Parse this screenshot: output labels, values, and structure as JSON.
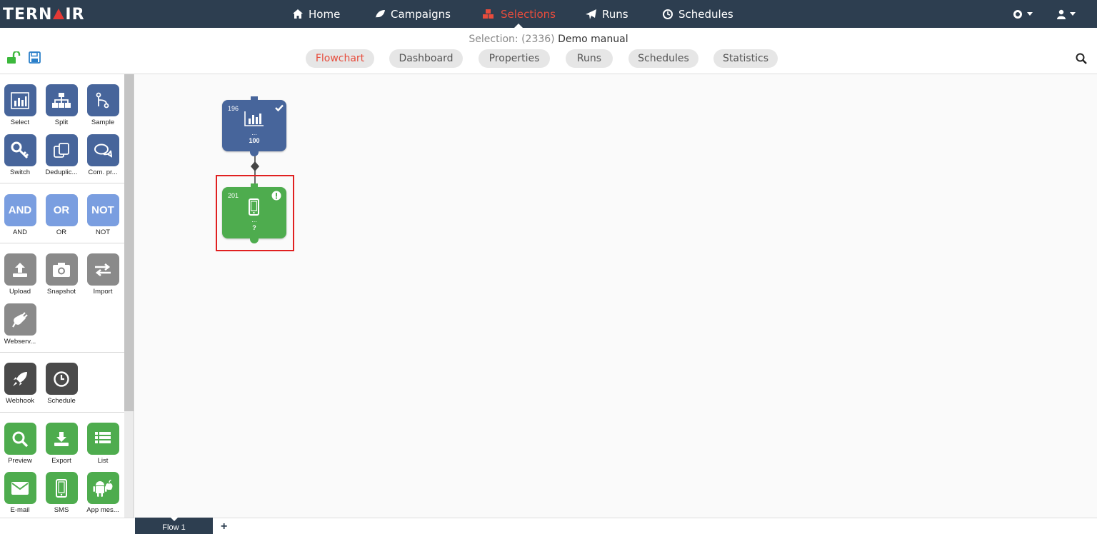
{
  "brand": {
    "logo_text_left": "TERN",
    "logo_text_right": "IR"
  },
  "nav": {
    "items": [
      {
        "label": "Home",
        "icon": "home-icon"
      },
      {
        "label": "Campaigns",
        "icon": "leaf-icon"
      },
      {
        "label": "Selections",
        "icon": "cubes-icon",
        "active": true
      },
      {
        "label": "Runs",
        "icon": "paper-plane-icon"
      },
      {
        "label": "Schedules",
        "icon": "clock-icon"
      }
    ],
    "right": [
      {
        "icon": "gear-icon"
      },
      {
        "icon": "user-icon"
      }
    ]
  },
  "selection": {
    "prefix": "Selection: (2336)",
    "name": "Demo manual"
  },
  "tabs": [
    "Flowchart",
    "Dashboard",
    "Properties",
    "Runs",
    "Schedules",
    "Statistics"
  ],
  "active_tab": "Flowchart",
  "colors": {
    "navbar": "#2d3e50",
    "active": "#e74c3c",
    "blue_tool": "#47659b",
    "logic_tool": "#7a9ee0",
    "gray_tool": "#8a8a8a",
    "dark_tool": "#4a4a4a",
    "green_tool": "#4eac4e"
  },
  "toolbox": {
    "selection_tools": [
      "Select",
      "Split",
      "Sample",
      "Switch",
      "Deduplic...",
      "Com. pr..."
    ],
    "logic_tools": [
      "AND",
      "OR",
      "NOT"
    ],
    "logic_labels": [
      "AND",
      "OR",
      "NOT"
    ],
    "data_tools": [
      "Upload",
      "Snapshot",
      "Import",
      "Webserv..."
    ],
    "trigger_tools": [
      "Webhook",
      "Schedule"
    ],
    "output_tools": [
      "Preview",
      "Export",
      "List",
      "E-mail",
      "SMS",
      "App mes..."
    ]
  },
  "flow": {
    "nodes": [
      {
        "id": "196",
        "type": "select",
        "status": "ok",
        "dots": "...",
        "count": "100"
      },
      {
        "id": "201",
        "type": "sms",
        "status": "warning",
        "dots": "...",
        "count": "?"
      }
    ]
  },
  "flow_tabs": {
    "active": "Flow 1",
    "add": "+"
  }
}
